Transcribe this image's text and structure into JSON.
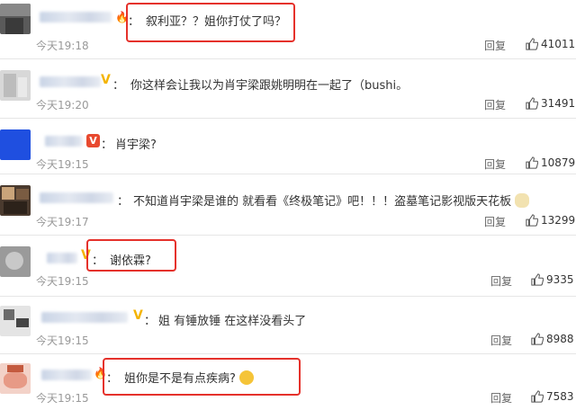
{
  "colors": {
    "highlight_box": "#e5312b",
    "time": "#999999",
    "vip_gold": "#f4b400",
    "vip_red": "#e8492f"
  },
  "ui": {
    "reply_label": "回复",
    "like_icon": "thumbs-up-icon"
  },
  "comments": [
    {
      "text": "叙利亚？？姐你打仗了吗？",
      "time": "今天19:18",
      "likes": "41011",
      "highlighted": true
    },
    {
      "text": "你这样会让我以为肖宇梁跟姚明明在一起了（bushi。",
      "time": "今天19:20",
      "likes": "31491",
      "highlighted": false
    },
    {
      "text": "肖宇梁?",
      "time": "今天19:15",
      "likes": "10879",
      "highlighted": false
    },
    {
      "text": "不知道肖宇梁是谁的 就看看《终极笔记》吧！！！盗墓笔记影视版天花板",
      "time": "今天19:17",
      "likes": "13299",
      "highlighted": false
    },
    {
      "text": "谢依霖?",
      "time": "今天19:15",
      "likes": "9335",
      "highlighted": true
    },
    {
      "text": "姐 有锤放锤 在这样没看头了",
      "time": "今天19:15",
      "likes": "8988",
      "highlighted": false
    },
    {
      "text": "姐你是不是有点疾病?",
      "time": "今天19:15",
      "likes": "7583",
      "highlighted": true
    }
  ]
}
